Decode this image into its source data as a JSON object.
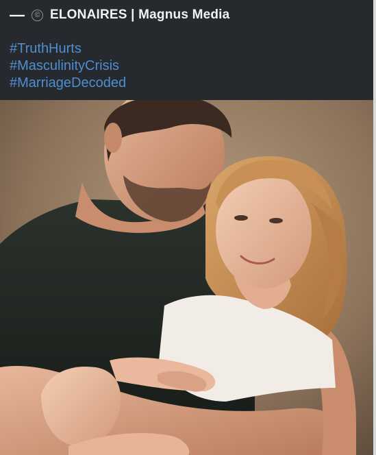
{
  "header": {
    "dash": "—",
    "copyright_symbol": "©",
    "channel_name": "ELONAIRES | Magnus Media"
  },
  "hashtags": [
    "#TruthHurts",
    "#MasculinityCrisis",
    "#MarriageDecoded"
  ],
  "colors": {
    "header_bg": "#26292d",
    "hashtag": "#4f8ed1",
    "title": "#f2f2f2"
  }
}
